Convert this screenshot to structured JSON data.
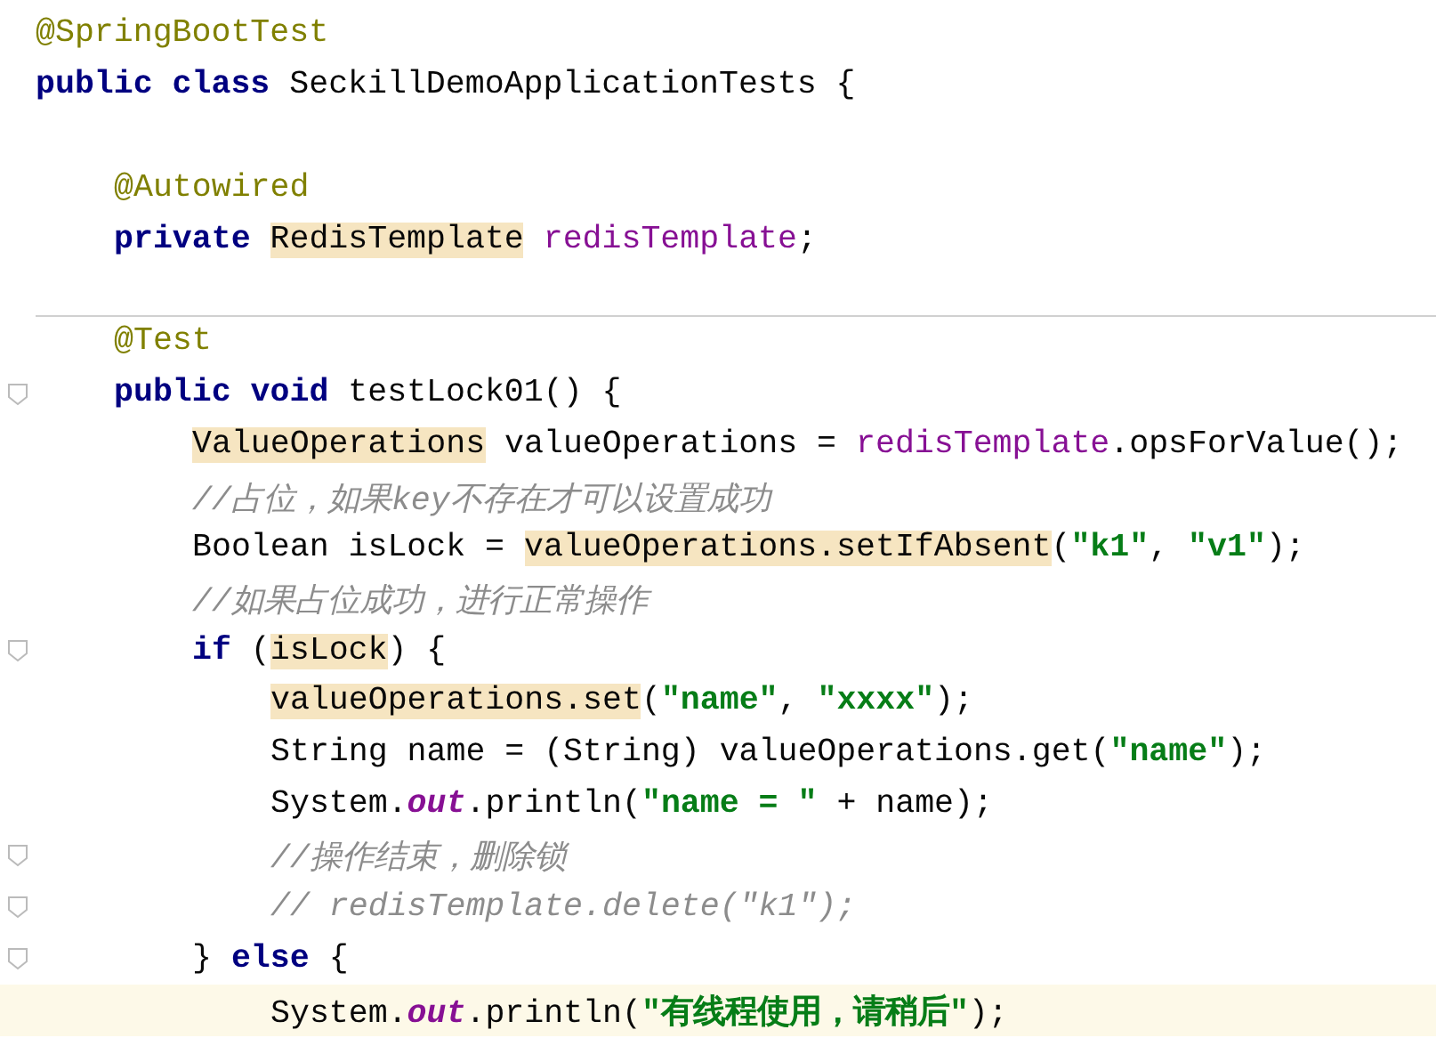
{
  "editor": {
    "lines": [
      {
        "kind": "code",
        "current": false,
        "fold_marker": false,
        "tokens": [
          {
            "kind": "annotation",
            "text": "@SpringBootTest"
          }
        ]
      },
      {
        "kind": "code",
        "current": false,
        "fold_marker": false,
        "tokens": [
          {
            "kind": "keyword",
            "text": "public class "
          },
          {
            "kind": "plain",
            "text": "SeckillDemoApplicationTests {"
          }
        ],
        "children": [
          {
            "kind": "blank",
            "current": false,
            "fold_marker": false
          },
          {
            "kind": "code",
            "current": false,
            "fold_marker": false,
            "tokens": [
              {
                "kind": "annotation",
                "text": "@Autowired"
              }
            ]
          },
          {
            "kind": "code",
            "current": false,
            "fold_marker": false,
            "tokens": [
              {
                "kind": "keyword",
                "text": "private "
              },
              {
                "kind": "usage",
                "text": "RedisTemplate"
              },
              {
                "kind": "field",
                "text": " redisTemplate"
              },
              {
                "kind": "plain",
                "text": ";"
              }
            ]
          },
          {
            "kind": "separator",
            "current": false,
            "fold_marker": false
          },
          {
            "kind": "code",
            "current": false,
            "fold_marker": false,
            "tokens": [
              {
                "kind": "annotation",
                "text": "@Test"
              }
            ]
          },
          {
            "kind": "code",
            "current": false,
            "fold_marker": true,
            "tokens": [
              {
                "kind": "keyword",
                "text": "public void "
              },
              {
                "kind": "plain",
                "text": "testLock01() {"
              }
            ],
            "children": [
              {
                "kind": "code",
                "current": false,
                "fold_marker": false,
                "tokens": [
                  {
                    "kind": "usage",
                    "text": "ValueOperations"
                  },
                  {
                    "kind": "plain",
                    "text": " valueOperations = "
                  },
                  {
                    "kind": "field",
                    "text": "redisTemplate"
                  },
                  {
                    "kind": "plain",
                    "text": ".opsForValue();"
                  }
                ]
              },
              {
                "kind": "code",
                "current": false,
                "fold_marker": false,
                "tokens": [
                  {
                    "kind": "comment",
                    "text": "//占位，如果key不存在才可以设置成功"
                  }
                ]
              },
              {
                "kind": "code",
                "current": false,
                "fold_marker": false,
                "tokens": [
                  {
                    "kind": "plain",
                    "text": "Boolean isLock = "
                  },
                  {
                    "kind": "usage",
                    "text": "valueOperations.setIfAbsent"
                  },
                  {
                    "kind": "plain",
                    "text": "("
                  },
                  {
                    "kind": "string",
                    "text": "\"k1\""
                  },
                  {
                    "kind": "plain",
                    "text": ", "
                  },
                  {
                    "kind": "string",
                    "text": "\"v1\""
                  },
                  {
                    "kind": "plain",
                    "text": ");"
                  }
                ]
              },
              {
                "kind": "code",
                "current": false,
                "fold_marker": false,
                "tokens": [
                  {
                    "kind": "comment",
                    "text": "//如果占位成功，进行正常操作"
                  }
                ]
              },
              {
                "kind": "code",
                "current": false,
                "fold_marker": true,
                "tokens": [
                  {
                    "kind": "keyword",
                    "text": "if "
                  },
                  {
                    "kind": "plain",
                    "text": "("
                  },
                  {
                    "kind": "usage",
                    "text": "isLock"
                  },
                  {
                    "kind": "plain",
                    "text": ") {"
                  }
                ],
                "children": [
                  {
                    "kind": "code",
                    "current": false,
                    "fold_marker": false,
                    "tokens": [
                      {
                        "kind": "usage",
                        "text": "valueOperations.set"
                      },
                      {
                        "kind": "plain",
                        "text": "("
                      },
                      {
                        "kind": "string",
                        "text": "\"name\""
                      },
                      {
                        "kind": "plain",
                        "text": ", "
                      },
                      {
                        "kind": "string",
                        "text": "\"xxxx\""
                      },
                      {
                        "kind": "plain",
                        "text": ");"
                      }
                    ]
                  },
                  {
                    "kind": "code",
                    "current": false,
                    "fold_marker": false,
                    "tokens": [
                      {
                        "kind": "plain",
                        "text": "String name = (String) valueOperations.get("
                      },
                      {
                        "kind": "string",
                        "text": "\"name\""
                      },
                      {
                        "kind": "plain",
                        "text": ");"
                      }
                    ]
                  },
                  {
                    "kind": "code",
                    "current": false,
                    "fold_marker": false,
                    "tokens": [
                      {
                        "kind": "plain",
                        "text": "System."
                      },
                      {
                        "kind": "static",
                        "text": "out"
                      },
                      {
                        "kind": "plain",
                        "text": ".println("
                      },
                      {
                        "kind": "string",
                        "text": "\"name = \""
                      },
                      {
                        "kind": "plain",
                        "text": " + name);"
                      }
                    ]
                  },
                  {
                    "kind": "code",
                    "current": false,
                    "fold_marker": true,
                    "tokens": [
                      {
                        "kind": "comment",
                        "text": "//操作结束，删除锁"
                      }
                    ]
                  },
                  {
                    "kind": "code",
                    "current": false,
                    "fold_marker": true,
                    "tokens": [
                      {
                        "kind": "comment",
                        "text": "// redisTemplate.delete(\"k1\");"
                      }
                    ]
                  }
                ]
              },
              {
                "kind": "code",
                "current": false,
                "fold_marker": true,
                "tokens": [
                  {
                    "kind": "plain",
                    "text": "} "
                  },
                  {
                    "kind": "keyword",
                    "text": "else "
                  },
                  {
                    "kind": "plain",
                    "text": "{"
                  }
                ],
                "children": [
                  {
                    "kind": "code",
                    "current": true,
                    "fold_marker": false,
                    "tokens": [
                      {
                        "kind": "plain",
                        "text": "System."
                      },
                      {
                        "kind": "static",
                        "text": "out"
                      },
                      {
                        "kind": "plain",
                        "text": ".println("
                      },
                      {
                        "kind": "string",
                        "text": "\"有线程使用，请稍后\""
                      },
                      {
                        "kind": "plain",
                        "text": ");"
                      }
                    ]
                  }
                ]
              }
            ]
          }
        ]
      }
    ]
  }
}
